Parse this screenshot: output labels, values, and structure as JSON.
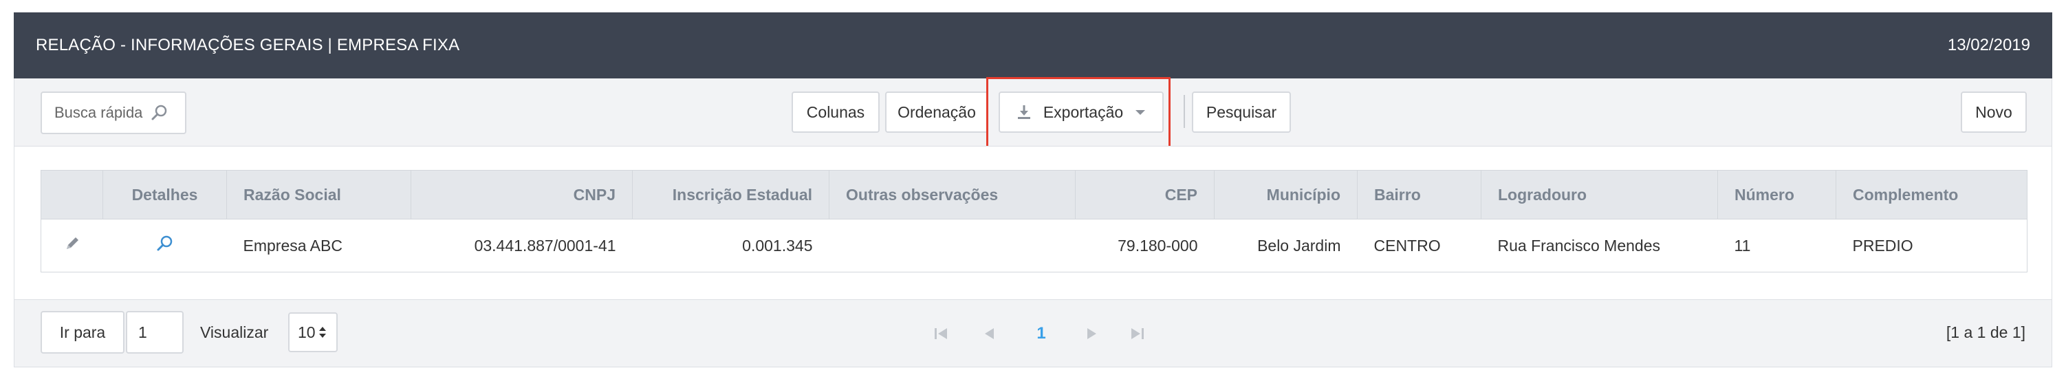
{
  "header": {
    "title": "RELAÇÃO - INFORMAÇÕES GERAIS | EMPRESA FIXA",
    "date": "13/02/2019"
  },
  "toolbar": {
    "search_placeholder": "Busca rápida",
    "colunas_label": "Colunas",
    "ordenacao_label": "Ordenação",
    "exportacao_label": "Exportação",
    "pesquisar_label": "Pesquisar",
    "novo_label": "Novo"
  },
  "table": {
    "columns": [
      "",
      "Detalhes",
      "Razão Social",
      "CNPJ",
      "Inscrição Estadual",
      "Outras observações",
      "CEP",
      "Município",
      "Bairro",
      "Logradouro",
      "Número",
      "Complemento"
    ],
    "rows": [
      {
        "razao_social": "Empresa ABC",
        "cnpj": "03.441.887/0001-41",
        "inscricao_estadual": "0.001.345",
        "outras_observacoes": "",
        "cep": "79.180-000",
        "municipio": "Belo Jardim",
        "bairro": "CENTRO",
        "logradouro": "Rua Francisco Mendes",
        "numero": "11",
        "complemento": "PREDIO"
      }
    ]
  },
  "footer": {
    "ir_para_label": "Ir para",
    "goto_value": "1",
    "visualizar_label": "Visualizar",
    "page_size": "10",
    "current_page": "1",
    "summary": "[1 a 1 de 1]"
  },
  "colors": {
    "header_bg": "#3d4451",
    "highlight": "#e43d2f",
    "page_link": "#3aa0e8",
    "icon_blue": "#3d8fd1",
    "icon_gray": "#8a9099"
  },
  "icons": [
    "search-icon",
    "download-icon",
    "caret-down-icon",
    "edit-pencil-icon",
    "details-search-icon",
    "first-page-icon",
    "prev-page-icon",
    "next-page-icon",
    "last-page-icon",
    "sort-arrows-icon"
  ]
}
